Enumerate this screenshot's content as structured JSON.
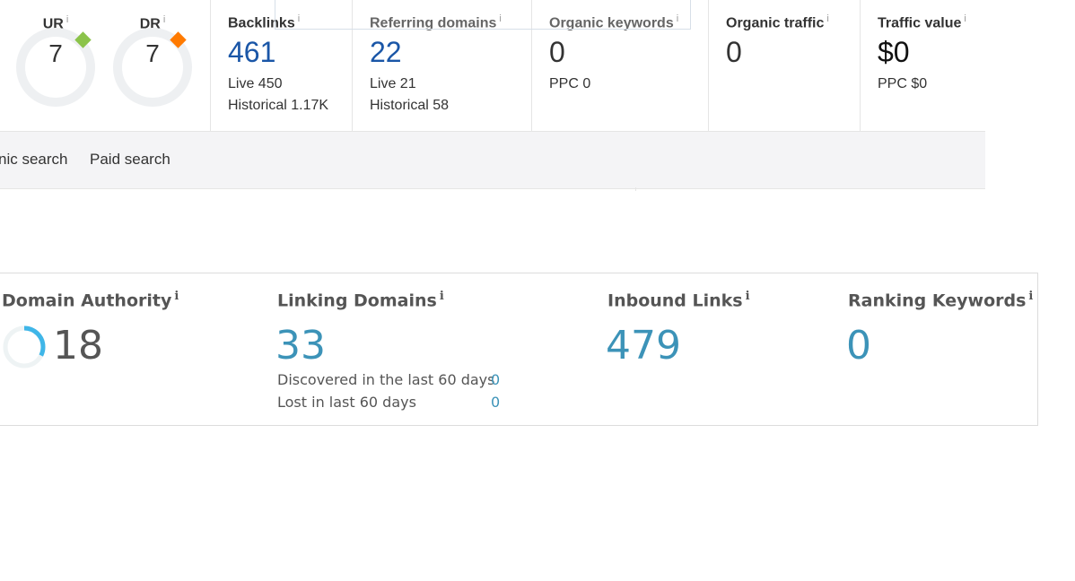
{
  "gauges": [
    {
      "label": "UR",
      "value": "7",
      "accent": "#8bc34a"
    },
    {
      "label": "DR",
      "value": "7",
      "accent": "#ff7a00"
    }
  ],
  "metrics": {
    "backlinks": {
      "label": "Backlinks",
      "value": "461",
      "sub1": "Live 450",
      "sub2": "Historical 1.17K"
    },
    "referring_domains": {
      "label": "Referring domains",
      "value": "22",
      "sub1": "Live 21",
      "sub2": "Historical 58"
    },
    "organic_keywords": {
      "label": "Organic keywords",
      "value": "0",
      "sub1": "PPC 0"
    },
    "organic_traffic": {
      "label": "Organic traffic",
      "value": "0"
    },
    "traffic_value": {
      "label": "Traffic value",
      "value": "$0",
      "sub1": "PPC $0"
    }
  },
  "info_glyph": "i",
  "tabs": {
    "organic": "nic search",
    "paid": "Paid search"
  },
  "moz": {
    "domain_authority": {
      "label": "Domain Authority",
      "value": "18",
      "fraction": 0.18
    },
    "linking_domains": {
      "label": "Linking Domains",
      "value": "33",
      "discovered_label": "Discovered in the last 60 days",
      "discovered_value": "0",
      "lost_label": "Lost in last 60 days",
      "lost_value": "0"
    },
    "inbound_links": {
      "label": "Inbound Links",
      "value": "479"
    },
    "ranking_keywords": {
      "label": "Ranking Keywords",
      "value": "0"
    }
  }
}
